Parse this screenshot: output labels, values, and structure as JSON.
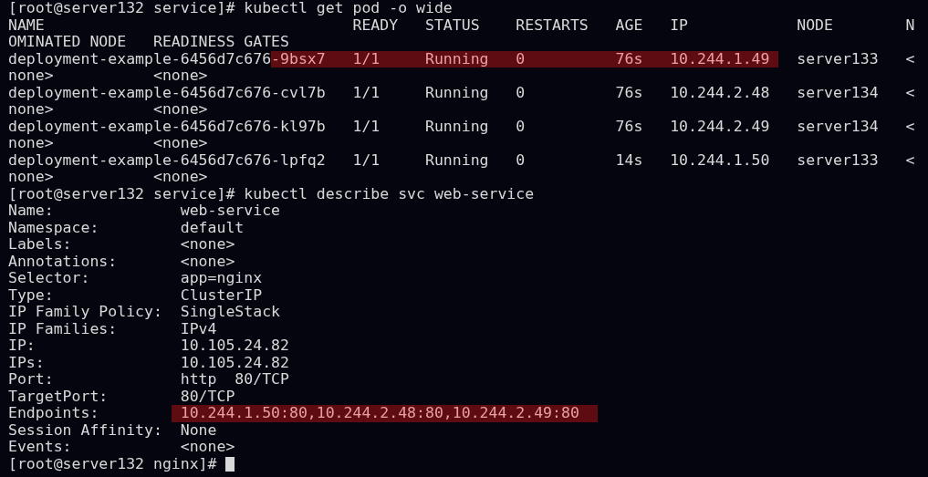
{
  "terminal": {
    "cursor_visible": true,
    "lines": [
      {
        "segments": [
          {
            "text": "[root@server132 service]# kubectl get pod -o wide",
            "highlighted": false
          }
        ]
      },
      {
        "segments": [
          {
            "text": "NAME                                  READY   STATUS    RESTARTS   AGE   IP            NODE        N",
            "highlighted": false
          }
        ]
      },
      {
        "segments": [
          {
            "text": "OMINATED NODE   READINESS GATES",
            "highlighted": false
          }
        ]
      },
      {
        "segments": [
          {
            "text": "deployment-example-6456d7c676",
            "highlighted": false
          },
          {
            "text": "-9bsx7   1/1     Running   0          76s   10.244.1.49 ",
            "highlighted": true
          },
          {
            "text": "  server133   <",
            "highlighted": false
          }
        ]
      },
      {
        "segments": [
          {
            "text": "none>           <none>",
            "highlighted": false
          }
        ]
      },
      {
        "segments": [
          {
            "text": "deployment-example-6456d7c676-cvl7b   1/1     Running   0          76s   10.244.2.48   server134   <",
            "highlighted": false
          }
        ]
      },
      {
        "segments": [
          {
            "text": "none>           <none>",
            "highlighted": false
          }
        ]
      },
      {
        "segments": [
          {
            "text": "deployment-example-6456d7c676-kl97b   1/1     Running   0          76s   10.244.2.49   server134   <",
            "highlighted": false
          }
        ]
      },
      {
        "segments": [
          {
            "text": "none>           <none>",
            "highlighted": false
          }
        ]
      },
      {
        "segments": [
          {
            "text": "deployment-example-6456d7c676-lpfq2   1/1     Running   0          14s   10.244.1.50   server133   <",
            "highlighted": false
          }
        ]
      },
      {
        "segments": [
          {
            "text": "none>           <none>",
            "highlighted": false
          }
        ]
      },
      {
        "segments": [
          {
            "text": "[root@server132 service]# kubectl describe svc web-service",
            "highlighted": false
          }
        ]
      },
      {
        "segments": [
          {
            "text": "Name:              web-service",
            "highlighted": false
          }
        ]
      },
      {
        "segments": [
          {
            "text": "Namespace:         default",
            "highlighted": false
          }
        ]
      },
      {
        "segments": [
          {
            "text": "Labels:            <none>",
            "highlighted": false
          }
        ]
      },
      {
        "segments": [
          {
            "text": "Annotations:       <none>",
            "highlighted": false
          }
        ]
      },
      {
        "segments": [
          {
            "text": "Selector:          app=nginx",
            "highlighted": false
          }
        ]
      },
      {
        "segments": [
          {
            "text": "Type:              ClusterIP",
            "highlighted": false
          }
        ]
      },
      {
        "segments": [
          {
            "text": "IP Family Policy:  SingleStack",
            "highlighted": false
          }
        ]
      },
      {
        "segments": [
          {
            "text": "IP Families:       IPv4",
            "highlighted": false
          }
        ]
      },
      {
        "segments": [
          {
            "text": "IP:                10.105.24.82",
            "highlighted": false
          }
        ]
      },
      {
        "segments": [
          {
            "text": "IPs:               10.105.24.82",
            "highlighted": false
          }
        ]
      },
      {
        "segments": [
          {
            "text": "Port:              http  80/TCP",
            "highlighted": false
          }
        ]
      },
      {
        "segments": [
          {
            "text": "TargetPort:        80/TCP",
            "highlighted": false
          }
        ]
      },
      {
        "segments": [
          {
            "text": "Endpoints:        ",
            "highlighted": false
          },
          {
            "text": " 10.244.1.50:80,10.244.2.48:80,10.244.2.49:80  ",
            "highlighted": true
          }
        ]
      },
      {
        "segments": [
          {
            "text": "Session Affinity:  None",
            "highlighted": false
          }
        ]
      },
      {
        "segments": [
          {
            "text": "Events:            <none>",
            "highlighted": false
          }
        ]
      },
      {
        "segments": [
          {
            "text": "[root@server132 nginx]# ",
            "highlighted": false
          }
        ]
      }
    ]
  }
}
